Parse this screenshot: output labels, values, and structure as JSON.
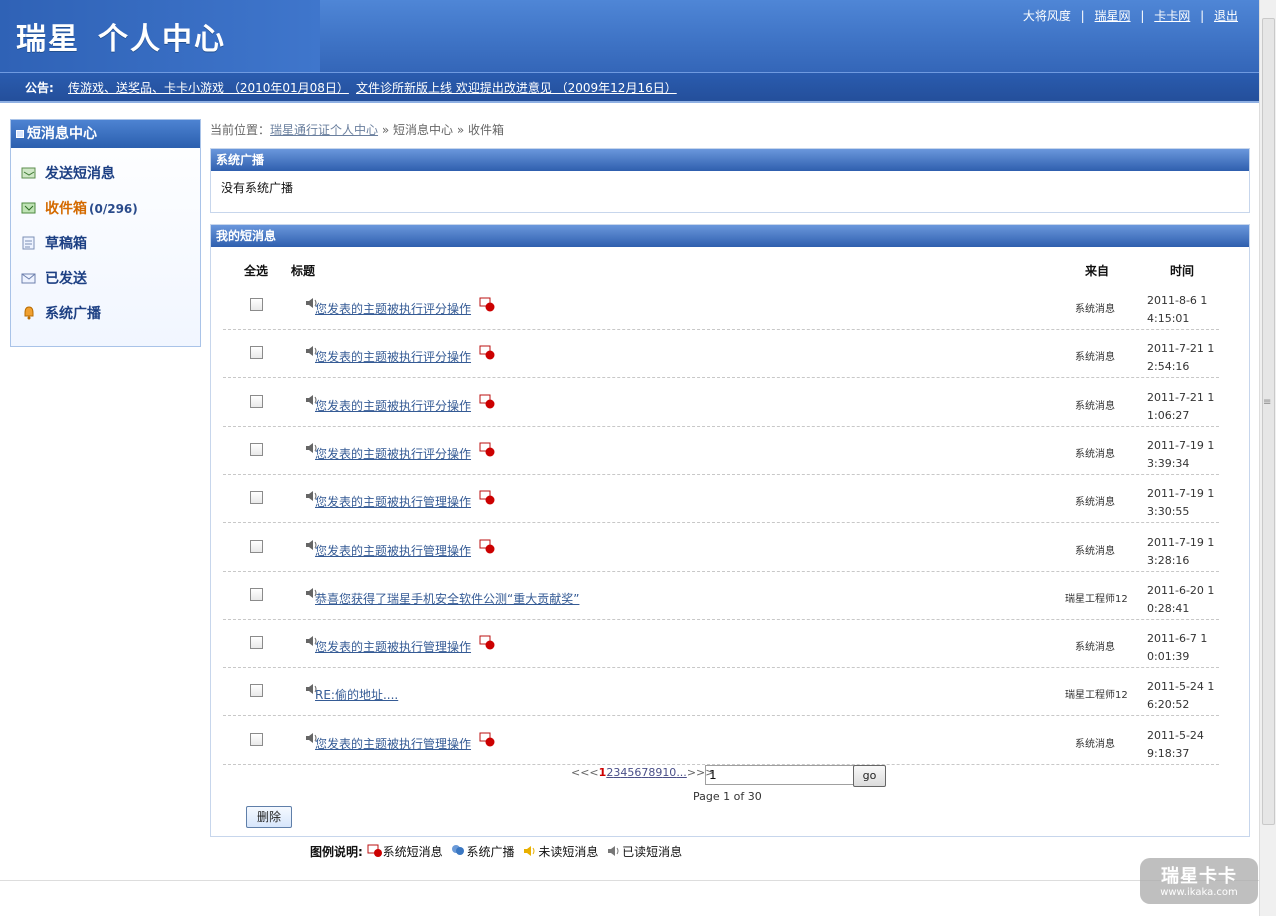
{
  "header": {
    "logo_main": "瑞星",
    "logo_sub": "个人中心",
    "top_links": [
      "大将风度",
      "瑞星网",
      "卡卡网",
      "退出"
    ]
  },
  "notice": {
    "label": "公告:",
    "items": [
      "传游戏、送奖品、卡卡小游戏 （2010年01月08日）",
      "文件诊所新版上线 欢迎提出改进意见 （2009年12月16日）"
    ]
  },
  "sidebar": {
    "title": "短消息中心",
    "items": [
      {
        "label": "发送短消息",
        "icon": "send-icon"
      },
      {
        "label": "收件箱",
        "count": "(0/296)",
        "icon": "inbox-icon"
      },
      {
        "label": "草稿箱",
        "icon": "draft-icon"
      },
      {
        "label": "已发送",
        "icon": "sent-icon"
      },
      {
        "label": "系统广播",
        "icon": "broadcast-icon"
      }
    ]
  },
  "breadcrumb": {
    "prefix": "当前位置：",
    "items": [
      "瑞星通行证个人中心",
      "短消息中心",
      "收件箱"
    ]
  },
  "broadcast_panel": {
    "title": "系统广播",
    "empty_text": "没有系统广播"
  },
  "messages_panel": {
    "title": "我的短消息",
    "headers": {
      "select_all": "全选",
      "title": "标题",
      "from": "来自",
      "time": "时间"
    },
    "rows": [
      {
        "title": "您发表的主题被执行评分操作",
        "from": "系统消息",
        "time": "2011-8-6 14:15:01",
        "system": true
      },
      {
        "title": "您发表的主题被执行评分操作",
        "from": "系统消息",
        "time": "2011-7-21 12:54:16",
        "system": true
      },
      {
        "title": "您发表的主题被执行评分操作",
        "from": "系统消息",
        "time": "2011-7-21 11:06:27",
        "system": true
      },
      {
        "title": "您发表的主题被执行评分操作",
        "from": "系统消息",
        "time": "2011-7-19 13:39:34",
        "system": true
      },
      {
        "title": "您发表的主题被执行管理操作",
        "from": "系统消息",
        "time": "2011-7-19 13:30:55",
        "system": true
      },
      {
        "title": "您发表的主题被执行管理操作",
        "from": "系统消息",
        "time": "2011-7-19 13:28:16",
        "system": true
      },
      {
        "title": "恭喜您获得了瑞星手机安全软件公测“重大贡献奖”",
        "from": "瑞星工程师12",
        "time": "2011-6-20 10:28:41",
        "system": false
      },
      {
        "title": "您发表的主题被执行管理操作",
        "from": "系统消息",
        "time": "2011-6-7 10:01:39",
        "system": true
      },
      {
        "title": "RE:偷的地址....",
        "from": "瑞星工程师12",
        "time": "2011-5-24 16:20:52",
        "system": false
      },
      {
        "title": "您发表的主题被执行管理操作",
        "from": "系统消息",
        "time": "2011-5-24 9:18:37",
        "system": true
      }
    ],
    "pager": {
      "prev": "<<<",
      "pages": [
        "1",
        "2",
        "3",
        "4",
        "5",
        "6",
        "7",
        "8",
        "9",
        "10"
      ],
      "more": "...",
      "next": ">>>",
      "goto_value": "1",
      "go_label": "go",
      "page_info": "Page 1 of 30"
    },
    "delete_label": "删除"
  },
  "legend": {
    "label": "图例说明:",
    "items": [
      "系统短消息",
      "系统广播",
      "未读短消息",
      "已读短消息"
    ]
  },
  "watermark": {
    "line1": "瑞星卡卡",
    "line2": "www.ikaka.com"
  }
}
